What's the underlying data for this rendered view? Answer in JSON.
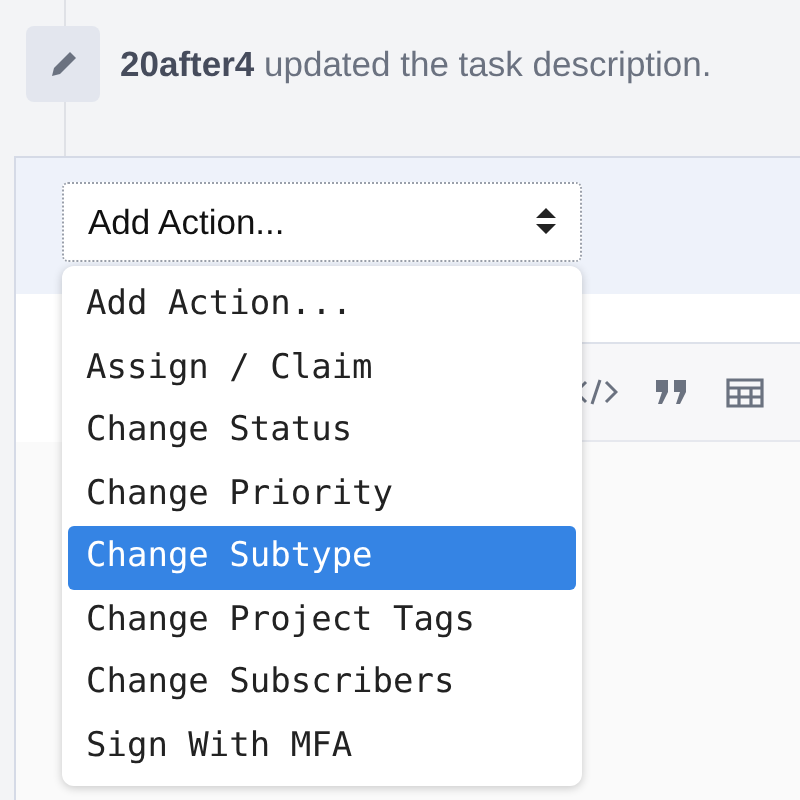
{
  "story": {
    "author": "20after4",
    "action": "updated the task description."
  },
  "action_select": {
    "value": "Add Action...",
    "expanded": true,
    "options": [
      {
        "label": "Add Action...",
        "highlighted": false
      },
      {
        "label": "Assign / Claim",
        "highlighted": false
      },
      {
        "label": "Change Status",
        "highlighted": false
      },
      {
        "label": "Change Priority",
        "highlighted": false
      },
      {
        "label": "Change Subtype",
        "highlighted": true
      },
      {
        "label": "Change Project Tags",
        "highlighted": false
      },
      {
        "label": "Change Subscribers",
        "highlighted": false
      },
      {
        "label": "Sign With MFA",
        "highlighted": false
      }
    ]
  }
}
